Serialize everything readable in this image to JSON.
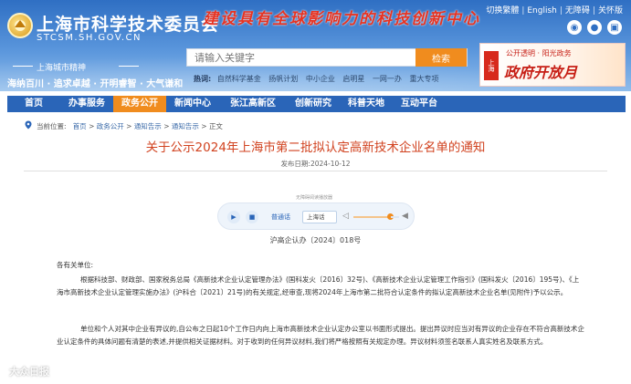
{
  "header": {
    "site_title": "上海市科学技术委员会",
    "site_domain": "STCSM.SH.GOV.CN",
    "slogan": "建设具有全球影响力的科技创新中心",
    "spirit_title": "上海城市精神",
    "spirit_text": "海纳百川 · 追求卓越 · 开明睿智 · 大气谦和",
    "top_links": [
      "切换繁體",
      "English",
      "无障碍",
      "关怀版"
    ],
    "social_icons": [
      "weibo-icon",
      "wechat-icon",
      "message-icon"
    ]
  },
  "search": {
    "placeholder": "请输入关键字",
    "button_label": "检索",
    "hot_label": "热词:",
    "hot_words": [
      "自然科学基金",
      "扬帆计划",
      "中小企业",
      "启明星",
      "一网一办",
      "重大专项"
    ]
  },
  "banner": {
    "badge": "上海",
    "subtitle": "公开透明 · 阳光政务",
    "title": "政府开放月"
  },
  "nav": {
    "items": [
      "首页",
      "办事服务",
      "政务公开",
      "新闻中心",
      "张江高新区",
      "创新研究",
      "科普天地",
      "互动平台"
    ],
    "active_index": 2
  },
  "breadcrumb": {
    "label": "当前位置:",
    "items": [
      "首页",
      "政务公开",
      "通知告示",
      "通知告示",
      "正文"
    ]
  },
  "article": {
    "title": "关于公示2024年上海市第二批拟认定高新技术企业名单的通知",
    "publish_label": "发布日期:",
    "publish_date": "2024-10-12",
    "doc_number": "沪高企认办〔2024〕018号",
    "salutation": "各有关单位:",
    "para1": "根据科技部、财政部、国家税务总局《高新技术企业认定管理办法》(国科发火〔2016〕32号)、《高新技术企业认定管理工作指引》(国科发火〔2016〕195号)、《上海市高新技术企业认定管理实施办法》(沪科合〔2021〕21号)的有关规定,经审查,现将2024年上海市第二批符合认定条件的拟认定高新技术企业名单(见附件)予以公示。",
    "para2": "单位和个人对其中企业有异议的,自公布之日起10个工作日内向上海市高新技术企业认定办公室以书面形式提出。提出异议时应当对有异议的企业存在不符合高新技术企业认定条件的具体问题有清楚的表述,并提供相关证据材料。对于收到的任何异议材料,我们将严格按照有关规定办理。异议材料须签名联系人真实姓名及联系方式。"
  },
  "player": {
    "caption": "无障碍阅读播放器",
    "speed_label": "普通话",
    "voice_label": "上海话",
    "volume_level": 0.82
  },
  "watermark": "大众日报"
}
